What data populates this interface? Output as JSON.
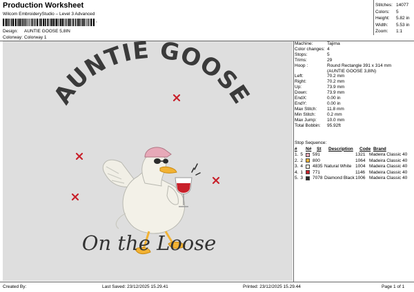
{
  "header": {
    "title": "Production Worksheet",
    "subtitle": "Wilcom EmbroideryStudio – Level 3 Advanced",
    "barcode_suffix": ",",
    "design_label": "Design:",
    "design_value": "AUNTIE GOOSE 5,8IN",
    "colorway_label": "Colorway:",
    "colorway_value": "Colorway 1"
  },
  "stats": {
    "stitches_label": "Stitches:",
    "stitches_value": "14077",
    "colors_label": "Colors:",
    "colors_value": "5",
    "height_label": "Height:",
    "height_value": "5.82 in",
    "width_label": "Width:",
    "width_value": "5.53 in",
    "zoom_label": "Zoom:",
    "zoom_value": "1:1"
  },
  "design": {
    "arc_text": "AUNTIE GOOSE",
    "script_text": "On the Loose"
  },
  "params": [
    {
      "label": "Machine:",
      "value": "Tajima"
    },
    {
      "label": "Color changes:",
      "value": "4"
    },
    {
      "label": "Stops:",
      "value": "5"
    },
    {
      "label": "Trims:",
      "value": "29"
    },
    {
      "label": "Hoop :",
      "value": "Round Rectangle 391 x 314 mm\n(AUNTIE GOOSE 3,8IN)"
    },
    {
      "label": "Left:",
      "value": "70.2 mm"
    },
    {
      "label": "Right:",
      "value": "70.2 mm"
    },
    {
      "label": "Up:",
      "value": "73.9 mm"
    },
    {
      "label": "Down:",
      "value": "73.9 mm"
    },
    {
      "label": "EndX:",
      "value": "0.00 in"
    },
    {
      "label": "EndY:",
      "value": "0.00 in"
    },
    {
      "label": "Max Stitch:",
      "value": "11.8 mm"
    },
    {
      "label": "Min Stitch:",
      "value": "0.2 mm"
    },
    {
      "label": "Max Jump:",
      "value": "10.0 mm"
    },
    {
      "label": "Total Bobbin:",
      "value": "95.92ft"
    }
  ],
  "stop_sequence_label": "Stop Sequence:",
  "color_table": {
    "headers": {
      "num": "#",
      "n": "N#",
      "st": "St",
      "desc": "Description",
      "code": "Code",
      "brand": "Brand"
    },
    "rows": [
      {
        "num": "1.",
        "n": "5",
        "color": "#e7a9b8",
        "st": "591",
        "desc": "",
        "code": "1321",
        "brand": "Madeira Classic 40"
      },
      {
        "num": "2.",
        "n": "2",
        "color": "#f2b233",
        "st": "800",
        "desc": "",
        "code": "1064",
        "brand": "Madeira Classic 40"
      },
      {
        "num": "3.",
        "n": "4",
        "color": "#f4f1e6",
        "st": "4835",
        "desc": "Natural White",
        "code": "1004",
        "brand": "Madeira Classic 40"
      },
      {
        "num": "4.",
        "n": "1",
        "color": "#c8202a",
        "st": "771",
        "desc": "",
        "code": "1146",
        "brand": "Madeira Classic 40"
      },
      {
        "num": "5.",
        "n": "3",
        "color": "#2b2b2b",
        "st": "7078",
        "desc": "Diamond Black",
        "code": "1006",
        "brand": "Madeira Classic 40"
      }
    ]
  },
  "footer": {
    "created_by": "Created By:",
    "last_saved": "Last Saved: 23/12/2025 15.29.41",
    "printed": "Printed: 23/12/2025 15.29.44",
    "page": "Page 1 of 1"
  }
}
